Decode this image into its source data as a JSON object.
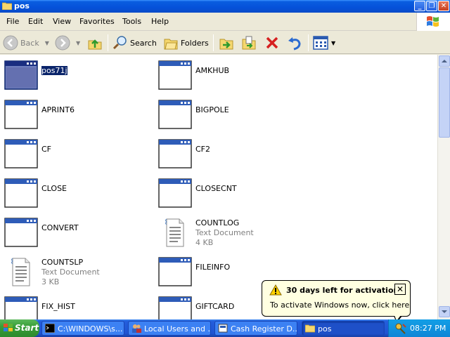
{
  "window": {
    "title": "pos",
    "controls": [
      "minimize-icon",
      "maximize-icon",
      "close-icon"
    ]
  },
  "menu": [
    "File",
    "Edit",
    "View",
    "Favorites",
    "Tools",
    "Help"
  ],
  "toolbar": {
    "back": "Back",
    "search": "Search",
    "folders": "Folders"
  },
  "files": [
    {
      "name": "pos71j",
      "type": "",
      "size": "",
      "icon": "window-file-icon",
      "selected": true
    },
    {
      "name": "AMKHUB",
      "type": "",
      "size": "",
      "icon": "window-file-icon"
    },
    {
      "name": "APRINT6",
      "type": "",
      "size": "",
      "icon": "window-file-icon"
    },
    {
      "name": "BIGPOLE",
      "type": "",
      "size": "",
      "icon": "window-file-icon"
    },
    {
      "name": "CF",
      "type": "",
      "size": "",
      "icon": "window-file-icon"
    },
    {
      "name": "CF2",
      "type": "",
      "size": "",
      "icon": "window-file-icon"
    },
    {
      "name": "CLOSE",
      "type": "",
      "size": "",
      "icon": "window-file-icon"
    },
    {
      "name": "CLOSECNT",
      "type": "",
      "size": "",
      "icon": "window-file-icon"
    },
    {
      "name": "CONVERT",
      "type": "",
      "size": "",
      "icon": "window-file-icon"
    },
    {
      "name": "COUNTLOG",
      "type": "Text Document",
      "size": "4 KB",
      "icon": "text-document-icon"
    },
    {
      "name": "COUNTSLP",
      "type": "Text Document",
      "size": "3 KB",
      "icon": "text-document-icon"
    },
    {
      "name": "FILEINFO",
      "type": "",
      "size": "",
      "icon": "window-file-icon"
    },
    {
      "name": "FIX_HIST",
      "type": "",
      "size": "",
      "icon": "window-file-icon"
    },
    {
      "name": "GIFTCARD",
      "type": "",
      "size": "",
      "icon": "window-file-icon"
    }
  ],
  "balloon": {
    "title": "30 days left for activation",
    "message": "To activate Windows now, click here",
    "close": "✕"
  },
  "taskbar": {
    "start": "Start",
    "tasks": [
      {
        "label": "C:\\WINDOWS\\s...",
        "icon": "cmd-icon"
      },
      {
        "label": "Local Users and ...",
        "icon": "users-icon"
      },
      {
        "label": "Cash Register D...",
        "icon": "app-icon"
      },
      {
        "label": "pos",
        "icon": "folder-icon"
      }
    ],
    "clock": "08:27 PM"
  }
}
